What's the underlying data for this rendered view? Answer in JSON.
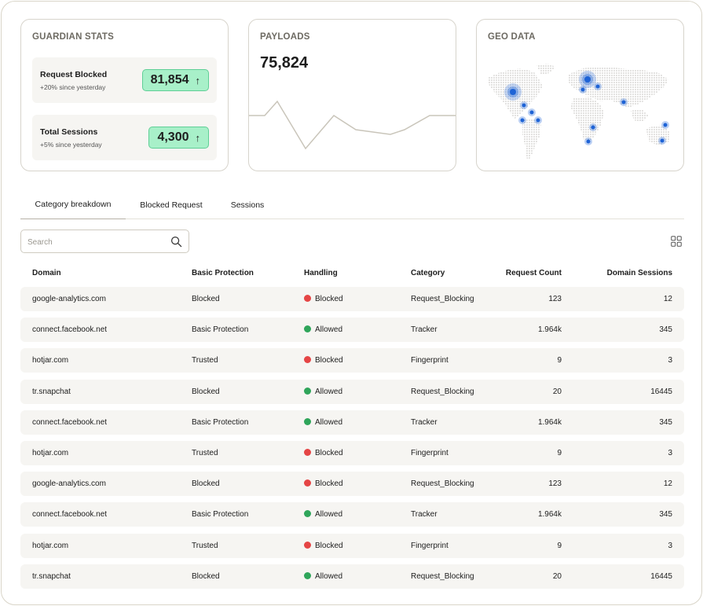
{
  "guardian": {
    "title": "GUARDIAN STATS",
    "stats": [
      {
        "label": "Request Blocked",
        "sub": "+20% since yesterday",
        "value": "81,854",
        "icon": "arrow-up-icon"
      },
      {
        "label": "Total Sessions",
        "sub": "+5% since yesterday",
        "value": "4,300",
        "icon": "arrow-up-icon"
      }
    ]
  },
  "payloads": {
    "title": "PAYLOADS",
    "value": "75,824",
    "sparkline": [
      0.6,
      0.6,
      0.75,
      0.25,
      0.6,
      0.45,
      0.4,
      0.45,
      0.6,
      0.6
    ]
  },
  "geo": {
    "title": "GEO DATA"
  },
  "tabs": [
    {
      "label": "Category breakdown",
      "active": true
    },
    {
      "label": "Blocked Request",
      "active": false
    },
    {
      "label": "Sessions",
      "active": false
    }
  ],
  "search": {
    "placeholder": "Search"
  },
  "table": {
    "headers": [
      "Domain",
      "Basic Protection",
      "Handling",
      "Category",
      "Request Count",
      "Domain Sessions"
    ],
    "rows": [
      {
        "domain": "google-analytics.com",
        "protection": "Blocked",
        "handling": "Blocked",
        "category": "Request_Blocking",
        "count": "123",
        "sessions": "12"
      },
      {
        "domain": "connect.facebook.net",
        "protection": "Basic Protection",
        "handling": "Allowed",
        "category": "Tracker",
        "count": "1.964k",
        "sessions": "345"
      },
      {
        "domain": "hotjar.com",
        "protection": "Trusted",
        "handling": "Blocked",
        "category": "Fingerprint",
        "count": "9",
        "sessions": "3"
      },
      {
        "domain": "tr.snapchat",
        "protection": "Blocked",
        "handling": "Allowed",
        "category": "Request_Blocking",
        "count": "20",
        "sessions": "16445"
      },
      {
        "domain": "connect.facebook.net",
        "protection": "Basic Protection",
        "handling": "Allowed",
        "category": "Tracker",
        "count": "1.964k",
        "sessions": "345"
      },
      {
        "domain": "hotjar.com",
        "protection": "Trusted",
        "handling": "Blocked",
        "category": "Fingerprint",
        "count": "9",
        "sessions": "3"
      },
      {
        "domain": "google-analytics.com",
        "protection": "Blocked",
        "handling": "Blocked",
        "category": "Request_Blocking",
        "count": "123",
        "sessions": "12"
      },
      {
        "domain": "connect.facebook.net",
        "protection": "Basic Protection",
        "handling": "Allowed",
        "category": "Tracker",
        "count": "1.964k",
        "sessions": "345"
      },
      {
        "domain": "hotjar.com",
        "protection": "Trusted",
        "handling": "Blocked",
        "category": "Fingerprint",
        "count": "9",
        "sessions": "3"
      },
      {
        "domain": "tr.snapchat",
        "protection": "Blocked",
        "handling": "Allowed",
        "category": "Request_Blocking",
        "count": "20",
        "sessions": "16445"
      }
    ]
  },
  "colors": {
    "blocked": "#e54545",
    "allowed": "#2fa55a",
    "pill_bg": "#a8f0c9",
    "marker": "#1e63d6"
  }
}
